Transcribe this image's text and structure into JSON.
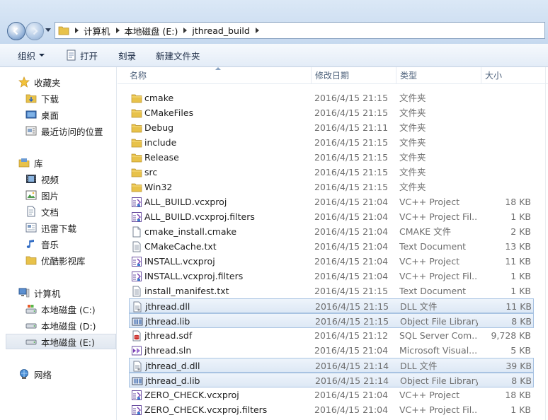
{
  "breadcrumbs": [
    "计算机",
    "本地磁盘 (E:)",
    "jthread_build"
  ],
  "toolbar": {
    "organize": "组织",
    "open": "打开",
    "burn": "刻录",
    "new_folder": "新建文件夹"
  },
  "nav": {
    "favorites": {
      "label": "收藏夹",
      "items": [
        "下载",
        "桌面",
        "最近访问的位置"
      ]
    },
    "libraries": {
      "label": "库",
      "items": [
        "视频",
        "图片",
        "文档",
        "迅雷下载",
        "音乐",
        "优酷影视库"
      ]
    },
    "computer": {
      "label": "计算机",
      "items": [
        "本地磁盘 (C:)",
        "本地磁盘 (D:)",
        "本地磁盘 (E:)"
      ],
      "selected": "本地磁盘 (E:)"
    },
    "network": {
      "label": "网络"
    }
  },
  "columns": {
    "name": "名称",
    "date": "修改日期",
    "type": "类型",
    "size": "大小"
  },
  "files": [
    {
      "name": "cmake",
      "date": "2016/4/15 21:15",
      "type": "文件夹",
      "size": "",
      "icon": "folder-icon"
    },
    {
      "name": "CMakeFiles",
      "date": "2016/4/15 21:15",
      "type": "文件夹",
      "size": "",
      "icon": "folder-icon"
    },
    {
      "name": "Debug",
      "date": "2016/4/15 21:11",
      "type": "文件夹",
      "size": "",
      "icon": "folder-icon"
    },
    {
      "name": "include",
      "date": "2016/4/15 21:15",
      "type": "文件夹",
      "size": "",
      "icon": "folder-icon"
    },
    {
      "name": "Release",
      "date": "2016/4/15 21:15",
      "type": "文件夹",
      "size": "",
      "icon": "folder-icon"
    },
    {
      "name": "src",
      "date": "2016/4/15 21:15",
      "type": "文件夹",
      "size": "",
      "icon": "folder-icon"
    },
    {
      "name": "Win32",
      "date": "2016/4/15 21:15",
      "type": "文件夹",
      "size": "",
      "icon": "folder-icon"
    },
    {
      "name": "ALL_BUILD.vcxproj",
      "date": "2016/4/15 21:04",
      "type": "VC++ Project",
      "size": "18 KB",
      "icon": "vcxproj-icon"
    },
    {
      "name": "ALL_BUILD.vcxproj.filters",
      "date": "2016/4/15 21:04",
      "type": "VC++ Project Fil...",
      "size": "1 KB",
      "icon": "vcxproj-icon"
    },
    {
      "name": "cmake_install.cmake",
      "date": "2016/4/15 21:04",
      "type": "CMAKE 文件",
      "size": "2 KB",
      "icon": "blank-file-icon"
    },
    {
      "name": "CMakeCache.txt",
      "date": "2016/4/15 21:04",
      "type": "Text Document",
      "size": "13 KB",
      "icon": "text-file-icon"
    },
    {
      "name": "INSTALL.vcxproj",
      "date": "2016/4/15 21:04",
      "type": "VC++ Project",
      "size": "11 KB",
      "icon": "vcxproj-icon"
    },
    {
      "name": "INSTALL.vcxproj.filters",
      "date": "2016/4/15 21:04",
      "type": "VC++ Project Fil...",
      "size": "1 KB",
      "icon": "vcxproj-icon"
    },
    {
      "name": "install_manifest.txt",
      "date": "2016/4/15 21:15",
      "type": "Text Document",
      "size": "1 KB",
      "icon": "text-file-icon"
    },
    {
      "name": "jthread.dll",
      "date": "2016/4/15 21:15",
      "type": "DLL 文件",
      "size": "11 KB",
      "icon": "dll-icon",
      "selected": true
    },
    {
      "name": "jthread.lib",
      "date": "2016/4/15 21:15",
      "type": "Object File Library",
      "size": "8 KB",
      "icon": "lib-icon",
      "selected": true
    },
    {
      "name": "jthread.sdf",
      "date": "2016/4/15 21:12",
      "type": "SQL Server Com...",
      "size": "9,728 KB",
      "icon": "sdf-icon"
    },
    {
      "name": "jthread.sln",
      "date": "2016/4/15 21:04",
      "type": "Microsoft Visual...",
      "size": "5 KB",
      "icon": "sln-icon"
    },
    {
      "name": "jthread_d.dll",
      "date": "2016/4/15 21:14",
      "type": "DLL 文件",
      "size": "39 KB",
      "icon": "dll-icon",
      "selected": true
    },
    {
      "name": "jthread_d.lib",
      "date": "2016/4/15 21:14",
      "type": "Object File Library",
      "size": "8 KB",
      "icon": "lib-icon",
      "selected": true
    },
    {
      "name": "ZERO_CHECK.vcxproj",
      "date": "2016/4/15 21:04",
      "type": "VC++ Project",
      "size": "18 KB",
      "icon": "vcxproj-icon"
    },
    {
      "name": "ZERO_CHECK.vcxproj.filters",
      "date": "2016/4/15 21:04",
      "type": "VC++ Project Fil...",
      "size": "1 KB",
      "icon": "vcxproj-icon"
    }
  ]
}
